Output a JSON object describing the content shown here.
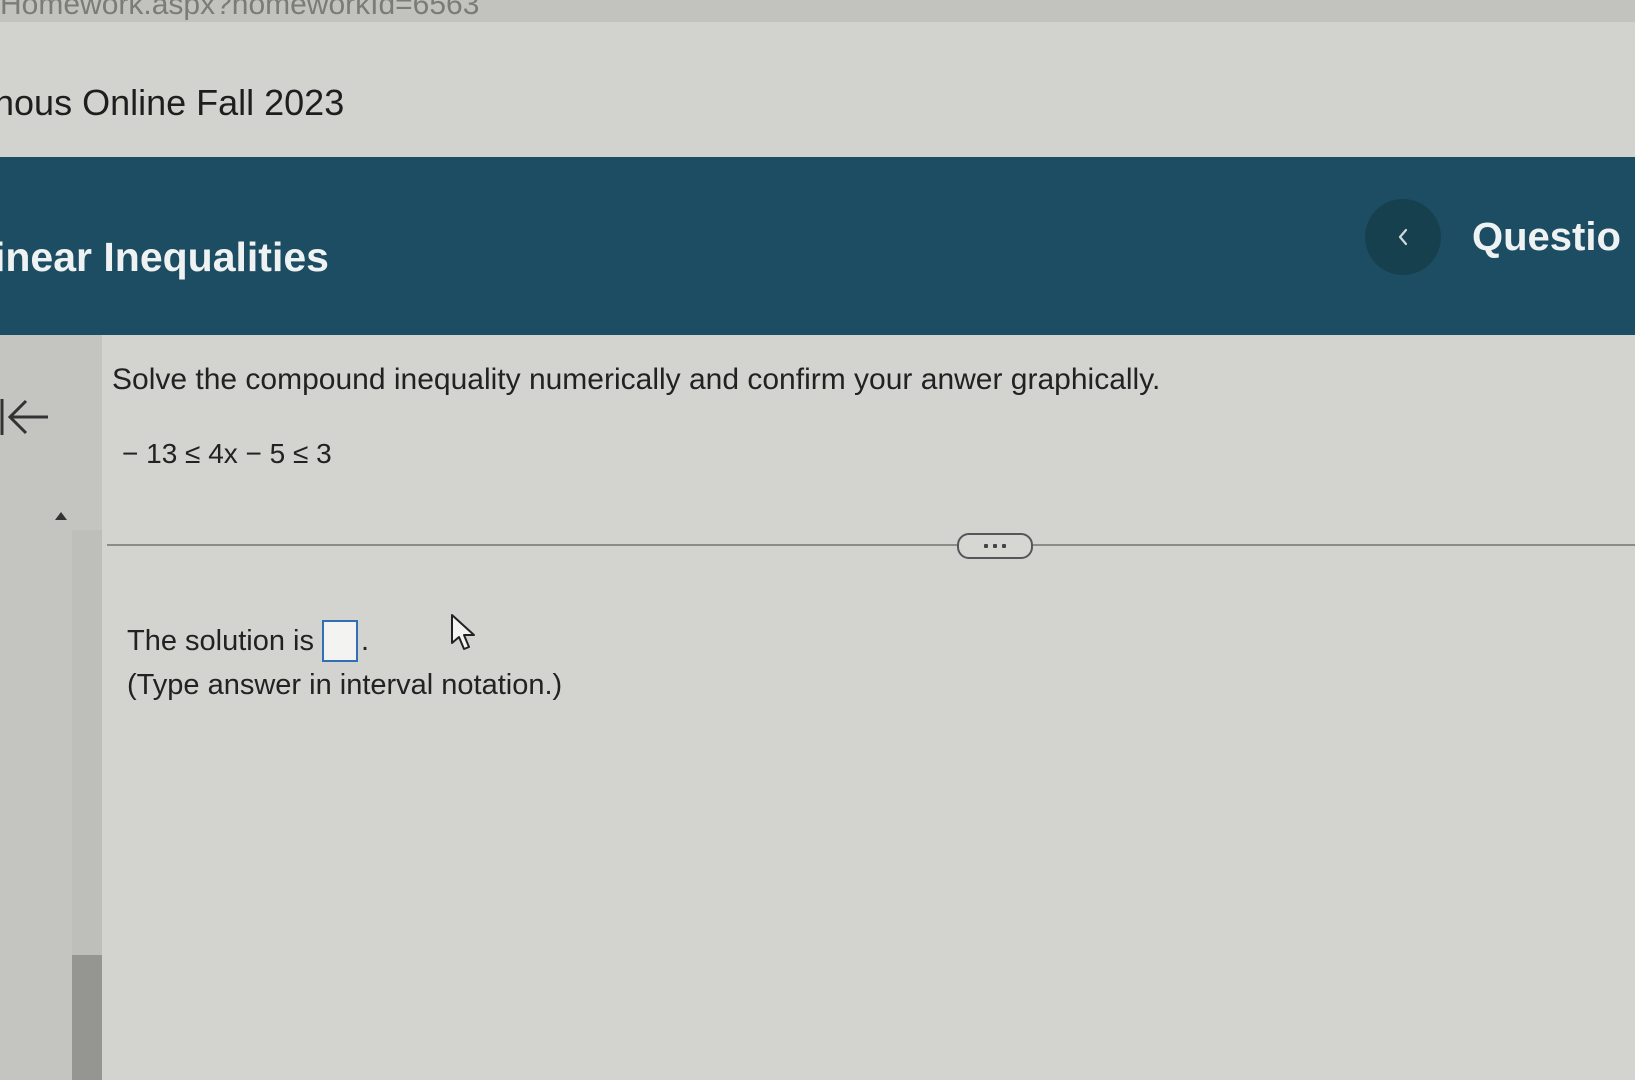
{
  "browser": {
    "url_fragment": "Homework.aspx?homeworkId=6563"
  },
  "course": {
    "title": "hous Online Fall 2023"
  },
  "header": {
    "section_title": "inear Inequalities",
    "prev_label": "<",
    "question_label": "Questio"
  },
  "question": {
    "instruction": "Solve the compound inequality numerically and confirm your anwer graphically.",
    "inequality": "− 13 ≤ 4x − 5 ≤ 3"
  },
  "answer": {
    "prefix": "The solution is",
    "value": "",
    "suffix": ".",
    "hint": "(Type answer in interval notation.)"
  },
  "colors": {
    "header_bg": "#1d4d62",
    "answer_box_border": "#2f6fb5"
  }
}
